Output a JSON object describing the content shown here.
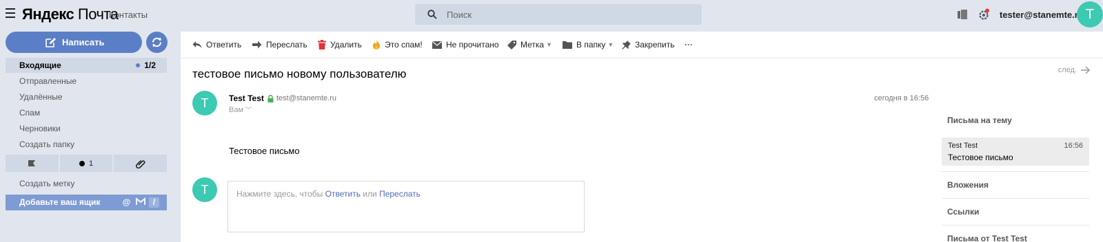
{
  "header": {
    "logo_yandex": "Яндекс",
    "logo_mail": "Почта",
    "contacts": "Контакты",
    "search_placeholder": "Поиск",
    "user_email": "tester@stanemte.ru",
    "avatar_letter": "T"
  },
  "sidebar": {
    "compose_label": "Написать",
    "folders": [
      {
        "label": "Входящие",
        "count": "1/2"
      },
      {
        "label": "Отправленные"
      },
      {
        "label": "Удалённые"
      },
      {
        "label": "Спам"
      },
      {
        "label": "Черновики"
      },
      {
        "label": "Создать папку"
      }
    ],
    "unread_filter_count": "1",
    "create_label": "Создать метку",
    "add_mailbox": "Добавьте ваш ящик"
  },
  "toolbar": {
    "reply": "Ответить",
    "forward": "Переслать",
    "delete": "Удалить",
    "spam": "Это спам!",
    "unread": "Не прочитано",
    "label": "Метка",
    "move": "В папку",
    "pin": "Закрепить",
    "more": "···"
  },
  "message": {
    "subject": "тестовое письмо новому пользователю",
    "next": "след.",
    "avatar_letter": "T",
    "sender_name": "Test Test",
    "sender_email": "test@stanemte.ru",
    "recipient": "Вам",
    "date": "сегодня в 16:56",
    "body": "Тестовое письмо",
    "reply_prompt": "Нажмите здесь, чтобы",
    "reply_link": "Ответить",
    "reply_or": "или",
    "forward_link": "Переслать"
  },
  "right_pane": {
    "thread_title": "Письма на тему",
    "thread_item": {
      "name": "Test Test",
      "time": "16:56",
      "subject": "Тестовое письмо"
    },
    "attachments": "Вложения",
    "links": "Ссылки",
    "from_sender": "Письма от Test Test"
  },
  "colors": {
    "accent": "#5b7fc6",
    "avatar": "#3dc9b2",
    "background": "#e1e6ee"
  }
}
